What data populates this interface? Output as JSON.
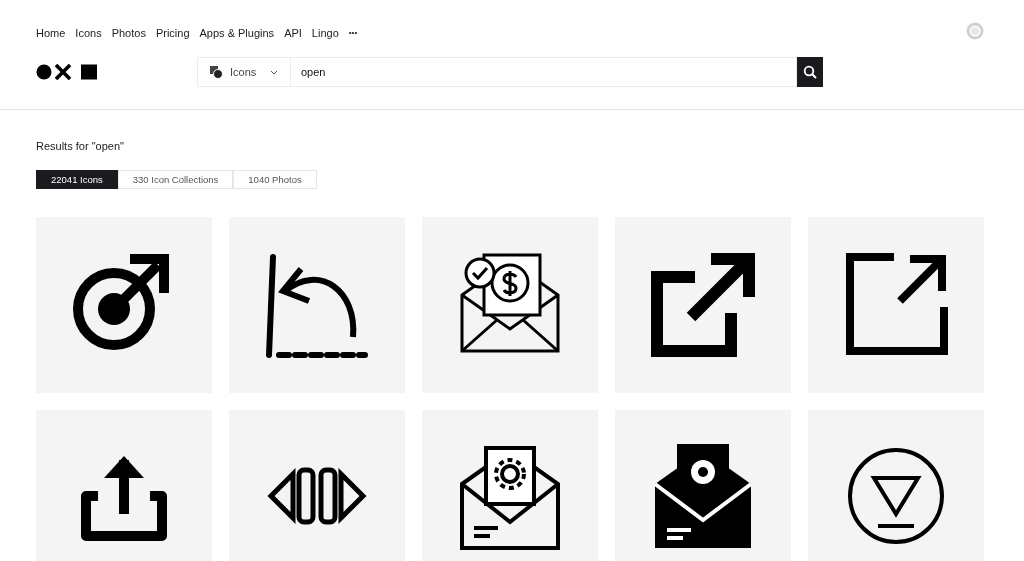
{
  "nav": {
    "links": [
      "Home",
      "Icons",
      "Photos",
      "Pricing",
      "Apps & Plugins",
      "API",
      "Lingo"
    ],
    "more": "•••"
  },
  "search": {
    "category": "Icons",
    "value": "open"
  },
  "results": {
    "heading": "Results for \"open\"",
    "tabs": [
      {
        "label": "22041 Icons",
        "selected": true
      },
      {
        "label": "330 Icon Collections",
        "selected": false
      },
      {
        "label": "1040 Photos",
        "selected": false
      }
    ]
  },
  "icons": [
    {
      "kind": "male"
    },
    {
      "kind": "undo"
    },
    {
      "kind": "invoice"
    },
    {
      "kind": "external"
    },
    {
      "kind": "expand"
    },
    {
      "kind": "share"
    },
    {
      "kind": "slider"
    },
    {
      "kind": "mailgear"
    },
    {
      "kind": "mailgearsolid"
    },
    {
      "kind": "triangle"
    }
  ]
}
